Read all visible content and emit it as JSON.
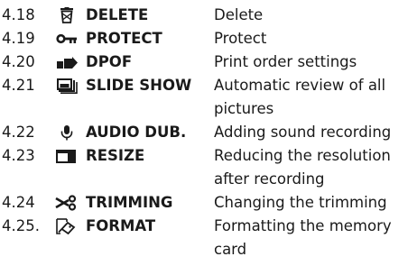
{
  "entries": [
    {
      "number": "4.18",
      "icon": "trash-icon",
      "name": "DELETE",
      "description": "Delete"
    },
    {
      "number": "4.19",
      "icon": "key-icon",
      "name": "PROTECT",
      "description": "Protect"
    },
    {
      "number": "4.20",
      "icon": "print-order-icon",
      "name": "DPOF",
      "description": "Print order settings"
    },
    {
      "number": "4.21",
      "icon": "slideshow-icon",
      "name": "SLIDE SHOW",
      "description": "Automatic review of all pictures"
    },
    {
      "number": "4.22",
      "icon": "microphone-icon",
      "name": "AUDIO DUB.",
      "description": "Adding sound recording"
    },
    {
      "number": "4.23",
      "icon": "resize-icon",
      "name": "RESIZE",
      "description": "Reducing the resolution after recording"
    },
    {
      "number": "4.24",
      "icon": "scissors-icon",
      "name": "TRIMMING",
      "description": "Changing the trimming"
    },
    {
      "number": "4.25.",
      "icon": "format-icon",
      "name": "FORMAT",
      "description": "Formatting the memory card"
    }
  ]
}
